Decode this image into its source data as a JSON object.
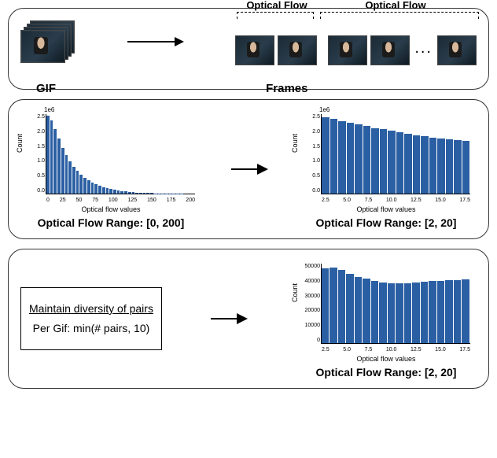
{
  "top": {
    "gif_label": "GIF",
    "frames_label": "Frames",
    "flow_label": "Optical Flow",
    "ellipsis": "..."
  },
  "mid": {
    "left_caption": "Optical Flow Range: [0, 200]",
    "right_caption": "Optical Flow Range: [2, 20]"
  },
  "bottom": {
    "box_title": "Maintain diversity of pairs",
    "box_line": "Per Gif: min(# pairs, 10)",
    "caption": "Optical Flow Range: [2, 20]"
  },
  "axis": {
    "ylabel": "Count",
    "xlabel": "Optical flow values",
    "yexp": "1e6"
  },
  "chart_data": [
    {
      "type": "bar",
      "id": "hist_full",
      "title": "",
      "xlabel": "Optical flow values",
      "ylabel": "Count",
      "y_scale_note": "1e6",
      "x_ticks": [
        "0",
        "25",
        "50",
        "75",
        "100",
        "125",
        "150",
        "175",
        "200"
      ],
      "y_ticks": [
        "0.0",
        "0.5",
        "1.0",
        "1.5",
        "2.0",
        "2.5"
      ],
      "xlim": [
        0,
        200
      ],
      "ylim": [
        0,
        2600000
      ],
      "categories": [
        0,
        5,
        10,
        15,
        20,
        25,
        30,
        35,
        40,
        45,
        50,
        55,
        60,
        65,
        70,
        75,
        80,
        85,
        90,
        95,
        100,
        105,
        110,
        115,
        120,
        125,
        130,
        135,
        140,
        145,
        150,
        155,
        160,
        165,
        170,
        175,
        180,
        185,
        190,
        195
      ],
      "values": [
        2550000,
        2400000,
        2100000,
        1800000,
        1500000,
        1250000,
        1050000,
        880000,
        740000,
        620000,
        520000,
        430000,
        360000,
        300000,
        250000,
        210000,
        175000,
        145000,
        120000,
        100000,
        82000,
        68000,
        56000,
        46000,
        38000,
        31000,
        25000,
        20000,
        16000,
        13000,
        10500,
        8400,
        6700,
        5300,
        4200,
        3300,
        2600,
        2000,
        1500,
        1100
      ]
    },
    {
      "type": "bar",
      "id": "hist_2_20_all",
      "title": "",
      "xlabel": "Optical flow values",
      "ylabel": "Count",
      "y_scale_note": "1e6",
      "x_ticks": [
        "2.5",
        "5.0",
        "7.5",
        "10.0",
        "12.5",
        "15.0",
        "17.5"
      ],
      "y_ticks": [
        "0.0",
        "0.5",
        "1.0",
        "1.5",
        "2.0",
        "2.5"
      ],
      "xlim": [
        2,
        20
      ],
      "ylim": [
        0,
        2700000
      ],
      "categories": [
        2,
        3,
        4,
        5,
        6,
        7,
        8,
        9,
        10,
        11,
        12,
        13,
        14,
        15,
        16,
        17,
        18,
        19
      ],
      "values": [
        2600000,
        2530000,
        2460000,
        2400000,
        2340000,
        2290000,
        2230000,
        2180000,
        2130000,
        2080000,
        2030000,
        1990000,
        1950000,
        1910000,
        1870000,
        1840000,
        1810000,
        1780000
      ]
    },
    {
      "type": "bar",
      "id": "hist_2_20_capped",
      "title": "",
      "xlabel": "Optical flow values",
      "ylabel": "Count",
      "x_ticks": [
        "2.5",
        "5.0",
        "7.5",
        "10.0",
        "12.5",
        "15.0",
        "17.5"
      ],
      "y_ticks": [
        "0",
        "10000",
        "20000",
        "30000",
        "40000",
        "50000"
      ],
      "xlim": [
        2,
        20
      ],
      "ylim": [
        0,
        55000
      ],
      "categories": [
        2,
        3,
        4,
        5,
        6,
        7,
        8,
        9,
        10,
        11,
        12,
        13,
        14,
        15,
        16,
        17,
        18,
        19
      ],
      "values": [
        52000,
        52500,
        50500,
        48000,
        46000,
        44500,
        43000,
        42000,
        41500,
        41300,
        41500,
        42000,
        42300,
        42800,
        43300,
        43500,
        43700,
        44000
      ]
    }
  ]
}
